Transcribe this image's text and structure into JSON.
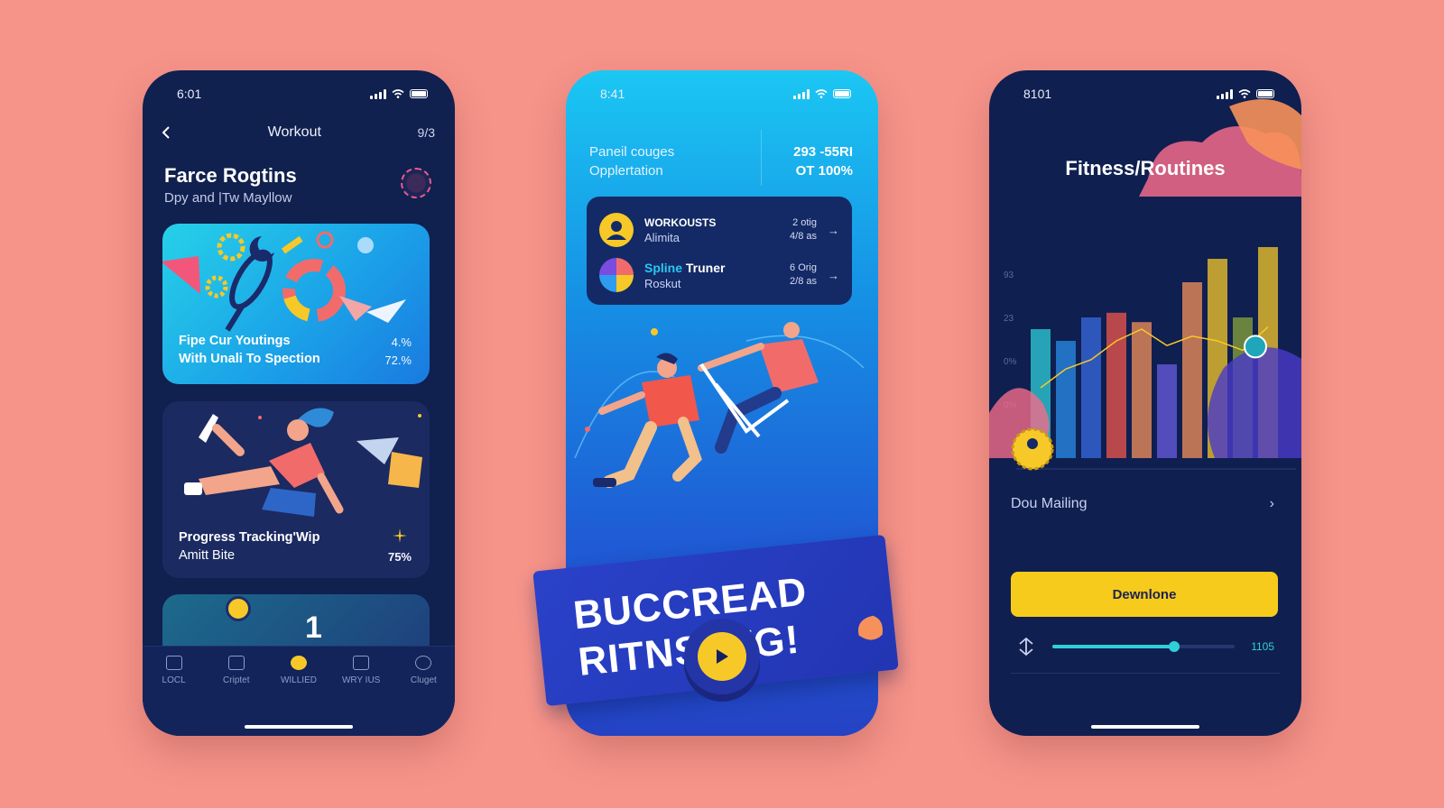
{
  "colors": {
    "background": "#f6948a",
    "navy": "#10204f",
    "accent_yellow": "#f7c928",
    "cyan": "#2fd0d8"
  },
  "phone1": {
    "status_time": "6:01",
    "header_title": "Workout",
    "header_num": "9/3",
    "heading": "Farce Rogtins",
    "subheading": "Dpy and |Tw Mayllow",
    "card1": {
      "line1": "Fipe Cur Youtings",
      "line2": "With Unali To Spection",
      "val1": "4.%",
      "val2": "72.%"
    },
    "card2": {
      "line1": "Progress Tracking'Wip",
      "line2": "Amitt Bite",
      "val": "75%"
    },
    "card3_num": "1",
    "nav": [
      {
        "label": "LOCL",
        "icon": "image-icon"
      },
      {
        "label": "Criptet",
        "icon": "cards-icon"
      },
      {
        "label": "WILLIED",
        "icon": "workout-icon"
      },
      {
        "label": "WRY IUS",
        "icon": "home-icon"
      },
      {
        "label": "Cluget",
        "icon": "search-icon"
      }
    ],
    "active_nav": 2
  },
  "phone2": {
    "status_time": "8:41",
    "panel_line1": "Paneil couges",
    "panel_line2": "Opplertation",
    "stat_line1": "293 -55RI",
    "stat_line2": "OT 100%",
    "rows": [
      {
        "title": "WORKOUSTS",
        "sub": "Alimita",
        "meta1": "2 otig",
        "meta2": "4/8 as"
      },
      {
        "title_hl": "Spline",
        "title": " Truner",
        "sub": "Roskut",
        "meta1": "6 Orig",
        "meta2": "2/8 as"
      }
    ],
    "banner_line1": "BUCCREAD",
    "banner_line2": "RITNSETG!"
  },
  "phone3": {
    "status_time": "8101",
    "title": "Fitness/Routines",
    "y_ticks": [
      "93",
      "23",
      "0%",
      "0%"
    ],
    "list_item": "Dou Mailing",
    "button": "Dewnlone",
    "time": "1105",
    "progress": 0.67
  },
  "chart_data": {
    "type": "bar",
    "title": "Fitness/Routines",
    "y_ticks": [
      "93",
      "23",
      "0%",
      "0%"
    ],
    "series": [
      {
        "values": [
          0.55,
          0.5,
          0.6,
          0.62,
          0.58,
          0.4,
          0.75,
          0.85,
          0.6,
          0.9
        ]
      }
    ],
    "line": [
      0.3,
      0.38,
      0.42,
      0.5,
      0.55,
      0.48,
      0.52,
      0.5,
      0.46,
      0.56
    ]
  }
}
